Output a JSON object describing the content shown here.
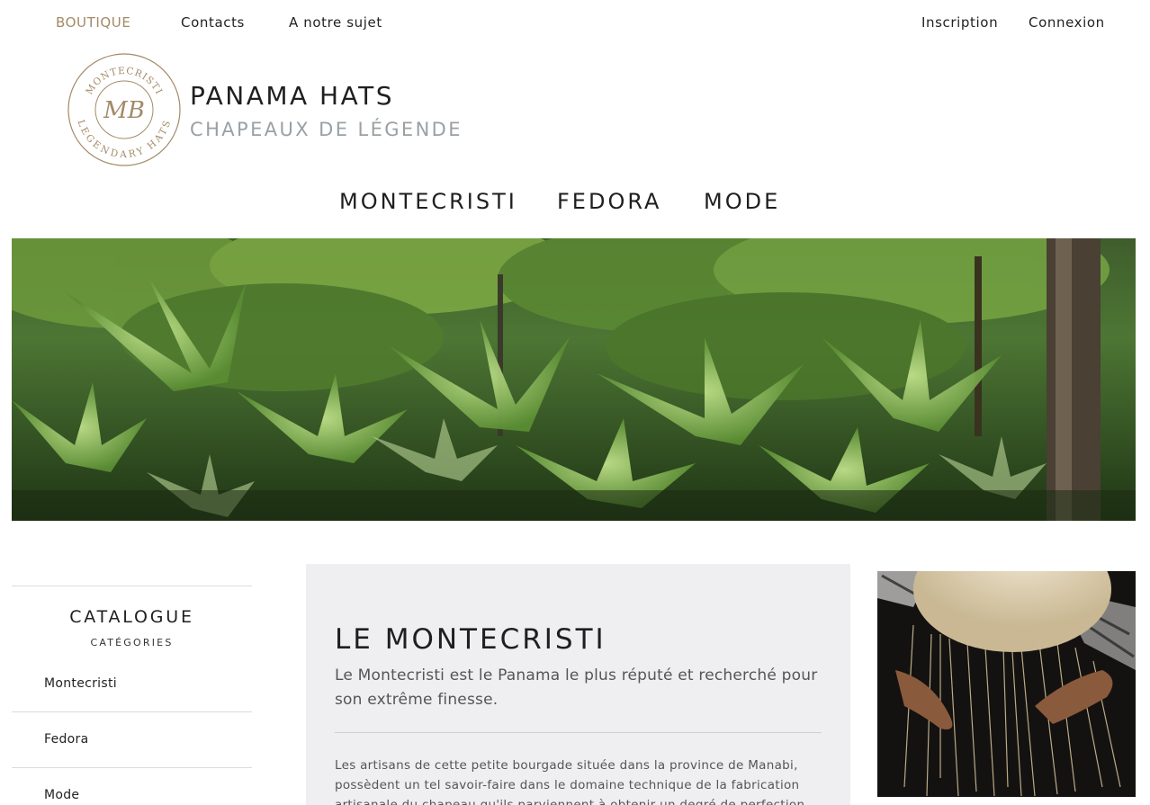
{
  "topnav": {
    "left": [
      "BOUTIQUE",
      "Contacts",
      "A notre sujet"
    ],
    "right": [
      "Inscription",
      "Connexion"
    ]
  },
  "logo": {
    "ring_top": "MONTECRISTI",
    "ring_bottom": "LEGENDARY HATS",
    "monogram": "MB"
  },
  "brand": {
    "title": "PANAMA HATS",
    "subtitle": "CHAPEAUX DE LÉGENDE"
  },
  "category_nav": [
    "MONTECRISTI",
    "FEDORA",
    "MODE"
  ],
  "sidebar": {
    "title": "CATALOGUE",
    "subtitle": "CATÉGORIES",
    "items": [
      "Montecristi",
      "Fedora",
      "Mode"
    ]
  },
  "article": {
    "title": "LE MONTECRISTI",
    "lead": "Le Montecristi est le Panama le plus réputé et recherché pour son extrême finesse.",
    "body": "Les artisans de cette petite bourgade située dans la province de Manabi, possèdent un tel savoir-faire dans le domaine technique de la fabrication artisanale du chapeau qu'ils parviennent à obtenir un degré de perfection"
  },
  "colors": {
    "accent": "#a38a67",
    "panel_bg": "#efeff1",
    "subtitle_grey": "#9aa0a4"
  }
}
